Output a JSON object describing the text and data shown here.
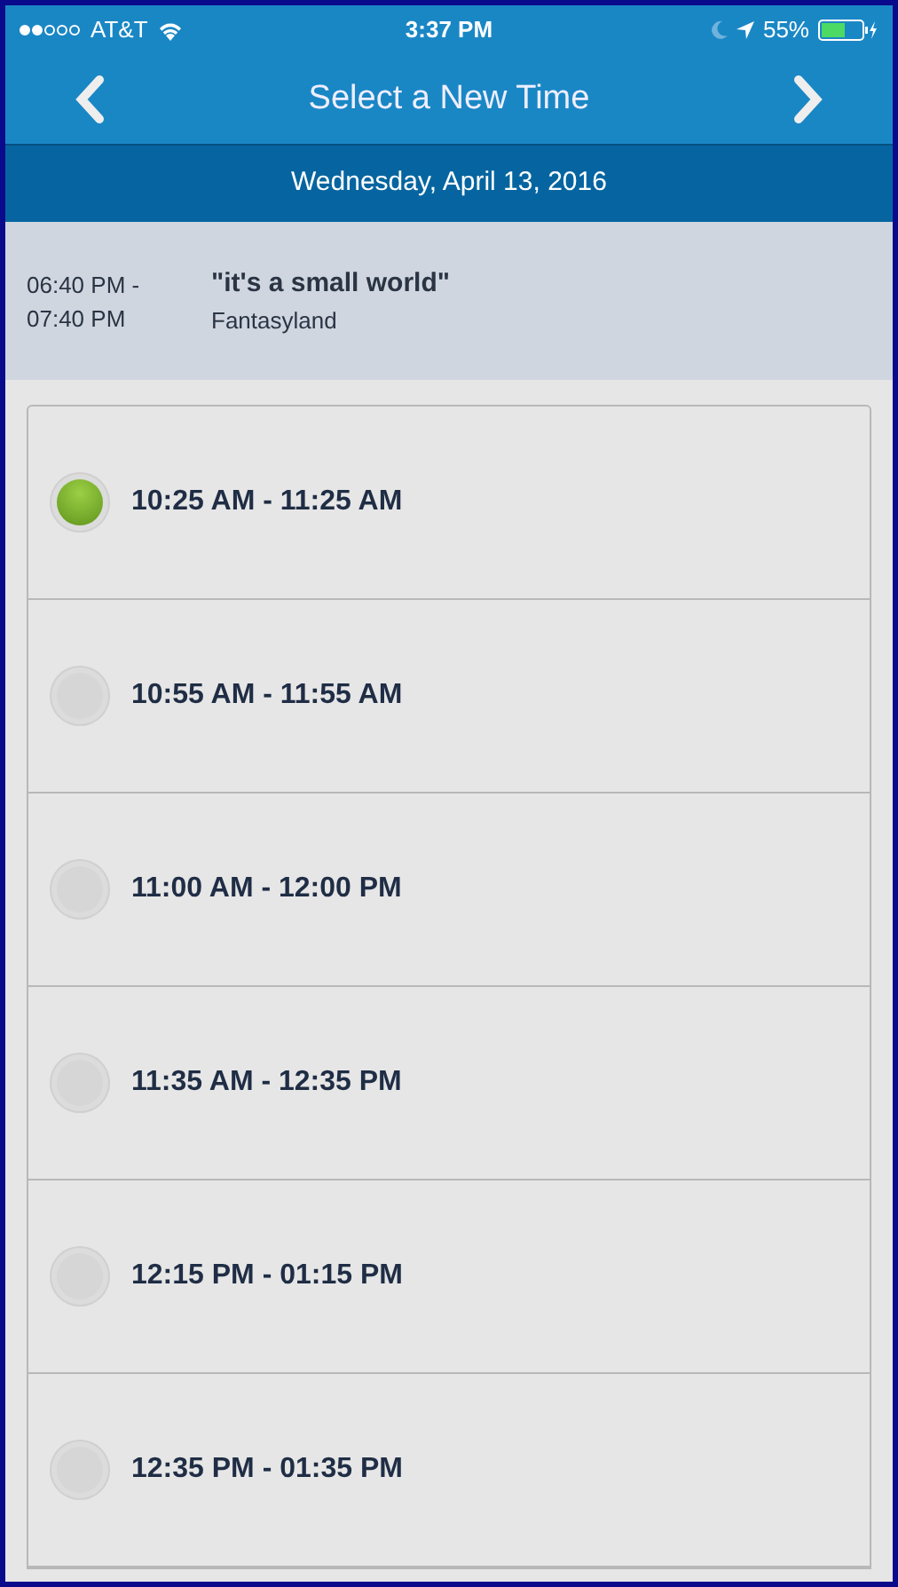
{
  "status_bar": {
    "carrier": "AT&T",
    "time": "3:37 PM",
    "battery": "55%"
  },
  "nav": {
    "title": "Select a New Time"
  },
  "date": "Wednesday, April 13, 2016",
  "current": {
    "time_start": "06:40 PM -",
    "time_end": "07:40 PM",
    "name": "\"it's a small world\"",
    "location": "Fantasyland"
  },
  "options": [
    {
      "label": "10:25 AM - 11:25 AM",
      "selected": true
    },
    {
      "label": "10:55 AM - 11:55 AM",
      "selected": false
    },
    {
      "label": "11:00 AM - 12:00 PM",
      "selected": false
    },
    {
      "label": "11:35 AM - 12:35 PM",
      "selected": false
    },
    {
      "label": "12:15 PM - 01:15 PM",
      "selected": false
    },
    {
      "label": "12:35 PM - 01:35 PM",
      "selected": false
    }
  ]
}
